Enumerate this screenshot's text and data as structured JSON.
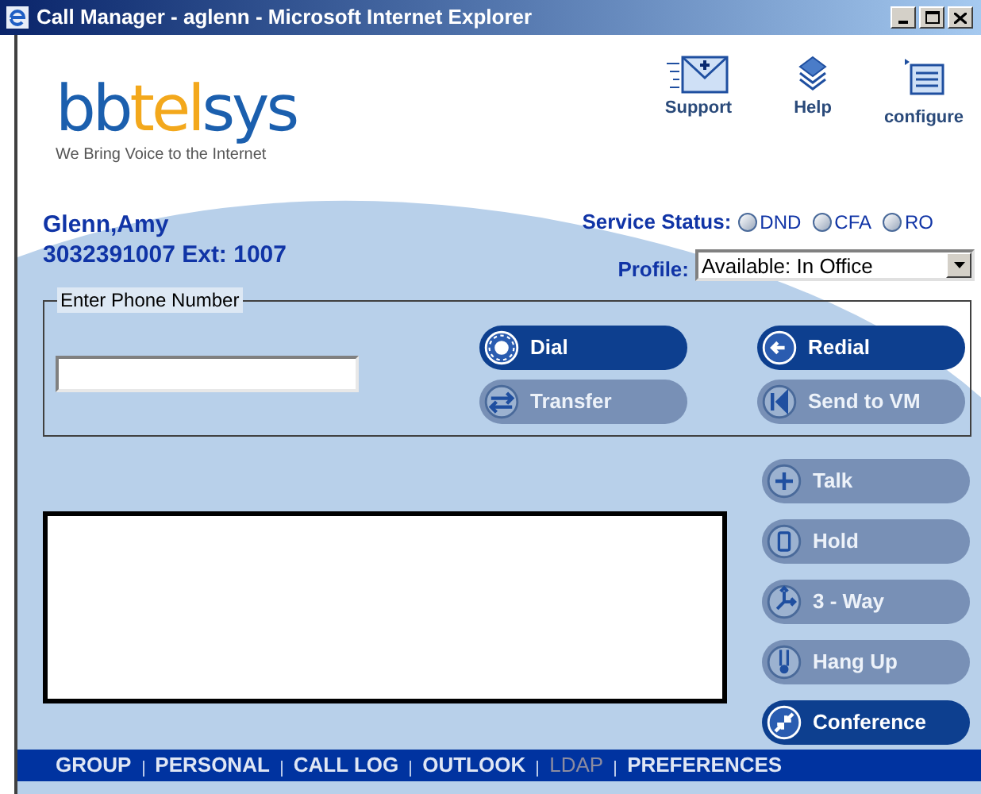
{
  "window": {
    "title": "Call Manager - aglenn - Microsoft Internet Explorer"
  },
  "logo": {
    "parts": [
      {
        "text": "bb",
        "color": "#1b5fae"
      },
      {
        "text": "tel",
        "color": "#f3a81c"
      },
      {
        "text": "sys",
        "color": "#1b5fae"
      }
    ],
    "tagline": "We Bring Voice to the Internet"
  },
  "toolbar": [
    {
      "label": "Support",
      "kind": "mail"
    },
    {
      "label": "Help",
      "kind": "stack"
    },
    {
      "label": "configure",
      "kind": "list"
    }
  ],
  "user": {
    "name": "Glenn,Amy",
    "number": "3032391007 Ext: 1007"
  },
  "service_status": {
    "label": "Service Status:",
    "options": [
      {
        "label": "DND",
        "checked": false
      },
      {
        "label": "CFA",
        "checked": false
      },
      {
        "label": "RO",
        "checked": false
      }
    ]
  },
  "profile": {
    "label": "Profile:",
    "value": "Available: In Office"
  },
  "phone_entry": {
    "legend": "Enter Phone Number",
    "buttons": [
      {
        "label": "Dial",
        "kind": "dial",
        "disabled": false
      },
      {
        "label": "Redial",
        "kind": "redial",
        "disabled": false
      },
      {
        "label": "Transfer",
        "kind": "transfer",
        "disabled": true
      },
      {
        "label": "Send to VM",
        "kind": "voicemail",
        "disabled": true
      }
    ]
  },
  "call_buttons": [
    {
      "label": "Talk",
      "kind": "talk",
      "disabled": true
    },
    {
      "label": "Hold",
      "kind": "hold",
      "disabled": true
    },
    {
      "label": "3 - Way",
      "kind": "threeway",
      "disabled": true
    },
    {
      "label": "Hang Up",
      "kind": "hangup",
      "disabled": true
    },
    {
      "label": "Conference",
      "kind": "conference",
      "disabled": false
    }
  ],
  "nav": [
    {
      "label": "GROUP",
      "disabled": false
    },
    {
      "label": "PERSONAL",
      "disabled": false
    },
    {
      "label": "CALL LOG",
      "disabled": false
    },
    {
      "label": "OUTLOOK",
      "disabled": false
    },
    {
      "label": "LDAP",
      "disabled": true
    },
    {
      "label": "PREFERENCES",
      "disabled": false
    }
  ]
}
